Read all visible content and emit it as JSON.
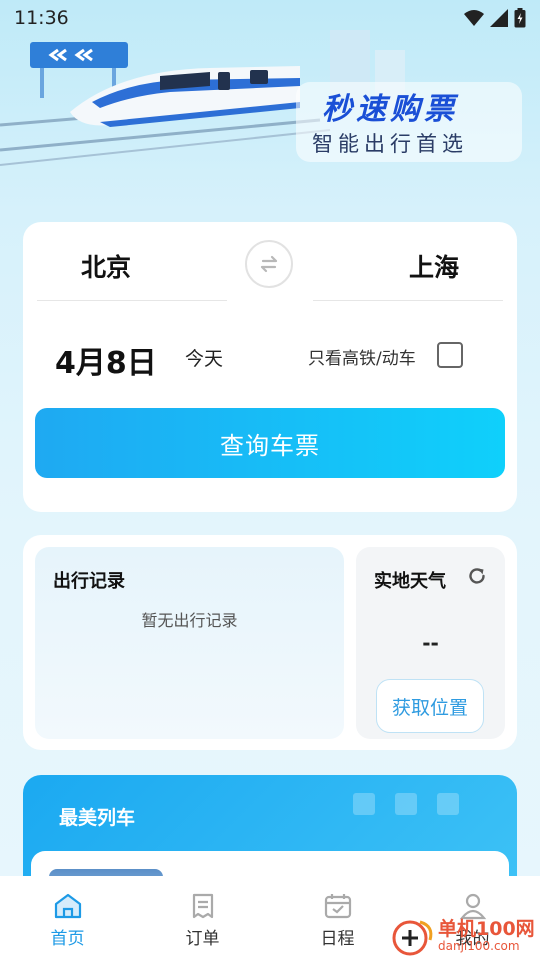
{
  "status": {
    "time": "11:36"
  },
  "banner": {
    "brand_title": "秒速购票",
    "brand_subtitle": "智能出行首选"
  },
  "search": {
    "from_city": "北京",
    "to_city": "上海",
    "date": "4月8日",
    "today_label": "今天",
    "filter_label": "只看高铁/动车",
    "filter_checked": false,
    "search_button": "查询车票"
  },
  "records": {
    "title": "出行记录",
    "empty_text": "暂无出行记录"
  },
  "weather": {
    "title": "实地天气",
    "value": "--",
    "location_button": "获取位置"
  },
  "trains": {
    "title": "最美列车"
  },
  "nav": {
    "items": [
      {
        "label": "首页",
        "icon": "home-icon",
        "active": true
      },
      {
        "label": "订单",
        "icon": "receipt-icon",
        "active": false
      },
      {
        "label": "日程",
        "icon": "calendar-icon",
        "active": false
      },
      {
        "label": "我的",
        "icon": "user-icon",
        "active": false
      }
    ]
  },
  "watermark": {
    "top": "单机100网",
    "bottom": "danji100.com"
  },
  "colors": {
    "accent": "#1d9ae6",
    "button_start": "#1fa9f2",
    "button_end": "#0fd0fb"
  }
}
